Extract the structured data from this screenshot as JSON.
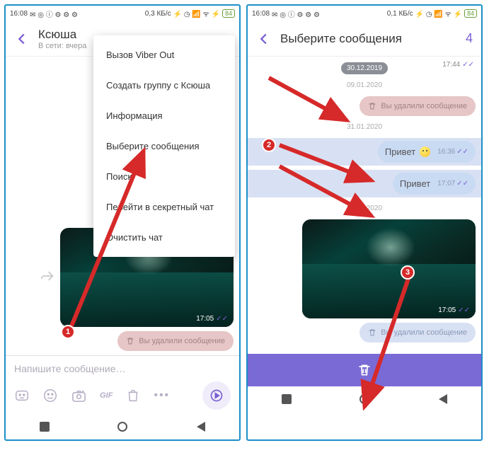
{
  "statusbar": {
    "time": "16:08",
    "speed1": "0,3 КБ/с",
    "speed2": "0,1 КБ/с",
    "battery": "84"
  },
  "left": {
    "header": {
      "title": "Ксюша",
      "subtitle": "В сети: вчера"
    },
    "menu": {
      "viber_out": "Вызов Viber Out",
      "create_group": "Создать группу с Ксюша",
      "info": "Информация",
      "select_messages": "Выберите сообщения",
      "search": "Поиск",
      "secret_chat": "Перейти в секретный чат",
      "clear_chat": "Очистить чат"
    },
    "image_ts": "17:05",
    "deleted_text": "Вы удалили сообщение",
    "input_placeholder": "Напишите сообщение…",
    "gif_label": "GIF"
  },
  "right": {
    "header": {
      "title": "Выберите сообщения",
      "count": "4"
    },
    "dates": {
      "d1": "30.12.2019",
      "d2": "09.01.2020",
      "d3": "31.01.2020",
      "d4": "03.02.2020"
    },
    "corner_ts": "17:44",
    "deleted_text": "Вы удалили сообщение",
    "msg1": {
      "text": "Привет",
      "ts": "16:36"
    },
    "msg2": {
      "text": "Привет",
      "ts": "17:07"
    },
    "image_ts": "17:05"
  }
}
